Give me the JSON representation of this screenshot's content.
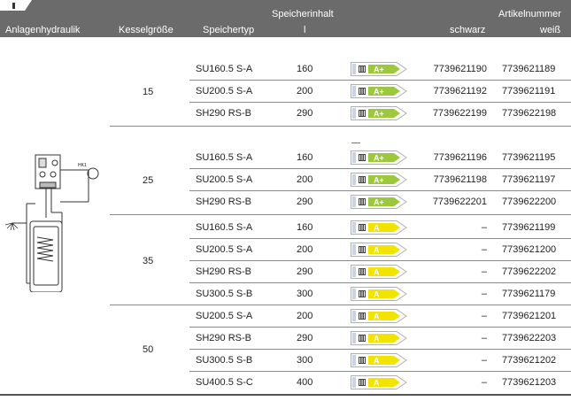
{
  "header": {
    "col_hydraulik": "Anlagenhydraulik",
    "col_kessel": "Kesselgröße",
    "col_speichertyp": "Speichertyp",
    "col_inhalt_top": "Speicherinhalt",
    "col_inhalt_unit": "l",
    "col_artikel_top": "Artikelnummer",
    "col_schwarz": "schwarz",
    "col_weiss": "weiß"
  },
  "diagram_label": "HK1",
  "colors": {
    "header_bg": "#6b6b6b",
    "label_green": "#9cc83c",
    "label_yellow": "#f2e400",
    "label_frame": "#b0b0b0"
  },
  "groups": [
    {
      "kessel": "15",
      "rows": [
        {
          "typ": "SU160.5 S-A",
          "liter": "160",
          "klasse": "A+",
          "schwarz": "7739621190",
          "weiss": "7739621189"
        },
        {
          "typ": "SU200.5 S-A",
          "liter": "200",
          "klasse": "A+",
          "schwarz": "7739621192",
          "weiss": "7739621191"
        },
        {
          "typ": "SH290 RS-B",
          "liter": "290",
          "klasse": "A+",
          "schwarz": "7739622199",
          "weiss": "7739622198"
        }
      ]
    },
    {
      "kessel": "25",
      "rows": [
        {
          "typ": "SU160.5 S-A",
          "liter": "160",
          "klasse": "A+",
          "schwarz": "7739621196",
          "weiss": "7739621195"
        },
        {
          "typ": "SU200.5 S-A",
          "liter": "200",
          "klasse": "A+",
          "schwarz": "7739621198",
          "weiss": "7739621197"
        },
        {
          "typ": "SH290 RS-B",
          "liter": "290",
          "klasse": "A+",
          "schwarz": "7739622201",
          "weiss": "7739622200"
        }
      ]
    },
    {
      "kessel": "35",
      "rows": [
        {
          "typ": "SU160.5 S-A",
          "liter": "160",
          "klasse": "A",
          "schwarz": "–",
          "weiss": "7739621199"
        },
        {
          "typ": "SU200.5 S-A",
          "liter": "200",
          "klasse": "A",
          "schwarz": "–",
          "weiss": "7739621200"
        },
        {
          "typ": "SH290 RS-B",
          "liter": "290",
          "klasse": "A",
          "schwarz": "–",
          "weiss": "7739622202"
        },
        {
          "typ": "SU300.5 S-B",
          "liter": "300",
          "klasse": "A",
          "schwarz": "–",
          "weiss": "7739621179"
        }
      ]
    },
    {
      "kessel": "50",
      "rows": [
        {
          "typ": "SU200.5 S-A",
          "liter": "200",
          "klasse": "A",
          "schwarz": "–",
          "weiss": "7739621201"
        },
        {
          "typ": "SH290 RS-B",
          "liter": "290",
          "klasse": "A",
          "schwarz": "–",
          "weiss": "7739622203"
        },
        {
          "typ": "SU300.5 S-B",
          "liter": "300",
          "klasse": "A",
          "schwarz": "–",
          "weiss": "7739621202"
        },
        {
          "typ": "SU400.5 S-C",
          "liter": "400",
          "klasse": "A",
          "schwarz": "–",
          "weiss": "7739621203"
        }
      ]
    }
  ]
}
